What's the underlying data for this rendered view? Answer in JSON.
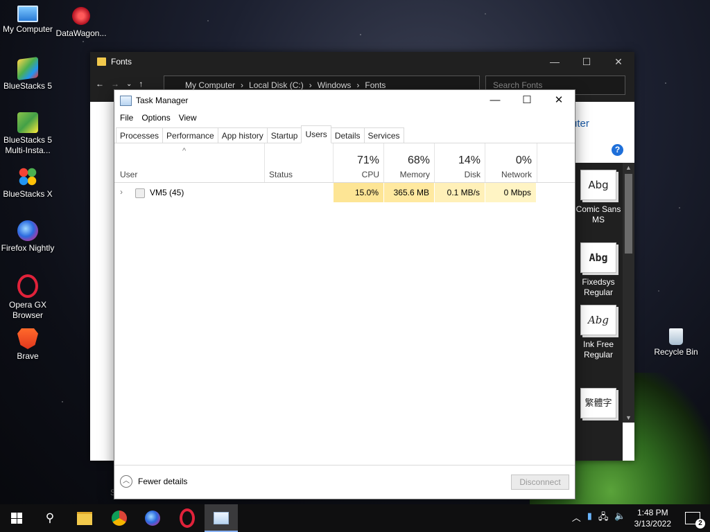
{
  "desktop": {
    "icons": [
      {
        "label": "My Computer"
      },
      {
        "label": "DataWagon..."
      },
      {
        "label": "BlueStacks 5"
      },
      {
        "label": "BlueStacks 5 Multi-Insta..."
      },
      {
        "label": "BlueStacks X"
      },
      {
        "label": "Firefox Nightly"
      },
      {
        "label": "Opera GX Browser"
      },
      {
        "label": "Brave"
      },
      {
        "label": "Recycle Bin"
      }
    ]
  },
  "fonts_window": {
    "title": "Fonts",
    "address": [
      "My Computer",
      "Local Disk (C:)",
      "Windows",
      "Fonts"
    ],
    "search_placeholder": "Search Fonts",
    "link_text": "uter",
    "side_letter": "S",
    "tiles": [
      {
        "sample": "Abg",
        "name": "Comic Sans MS"
      },
      {
        "sample": "Abg",
        "name": "Fixedsys Regular"
      },
      {
        "sample": "Abg",
        "name": "Ink Free Regular"
      },
      {
        "sample": "繁體字",
        "name": ""
      }
    ]
  },
  "task_manager": {
    "title": "Task Manager",
    "menu": [
      "File",
      "Options",
      "View"
    ],
    "tabs": [
      "Processes",
      "Performance",
      "App history",
      "Startup",
      "Users",
      "Details",
      "Services"
    ],
    "active_tab": "Users",
    "columns": {
      "user": "User",
      "status": "Status",
      "cpu": {
        "pct": "71%",
        "label": "CPU"
      },
      "memory": {
        "pct": "68%",
        "label": "Memory"
      },
      "disk": {
        "pct": "14%",
        "label": "Disk"
      },
      "network": {
        "pct": "0%",
        "label": "Network"
      }
    },
    "rows": [
      {
        "user": "VM5 (45)",
        "status": "",
        "cpu": "15.0%",
        "memory": "365.6 MB",
        "disk": "0.1 MB/s",
        "network": "0 Mbps"
      }
    ],
    "footer": {
      "fewer_details": "Fewer details",
      "disconnect": "Disconnect"
    }
  },
  "taskbar": {
    "apps": [
      "start-button",
      "search",
      "file-explorer",
      "chrome",
      "firefox-nightly",
      "opera-gx",
      "task-manager"
    ],
    "active_app": "task-manager",
    "clock": {
      "time": "1:48 PM",
      "date": "3/13/2022"
    },
    "notification_count": "2"
  },
  "colors": {
    "heat_light": "#fff4c4",
    "heat_mid": "#ffe9a0",
    "heat_strong": "#fde595",
    "accent": "#1e6fd9"
  }
}
